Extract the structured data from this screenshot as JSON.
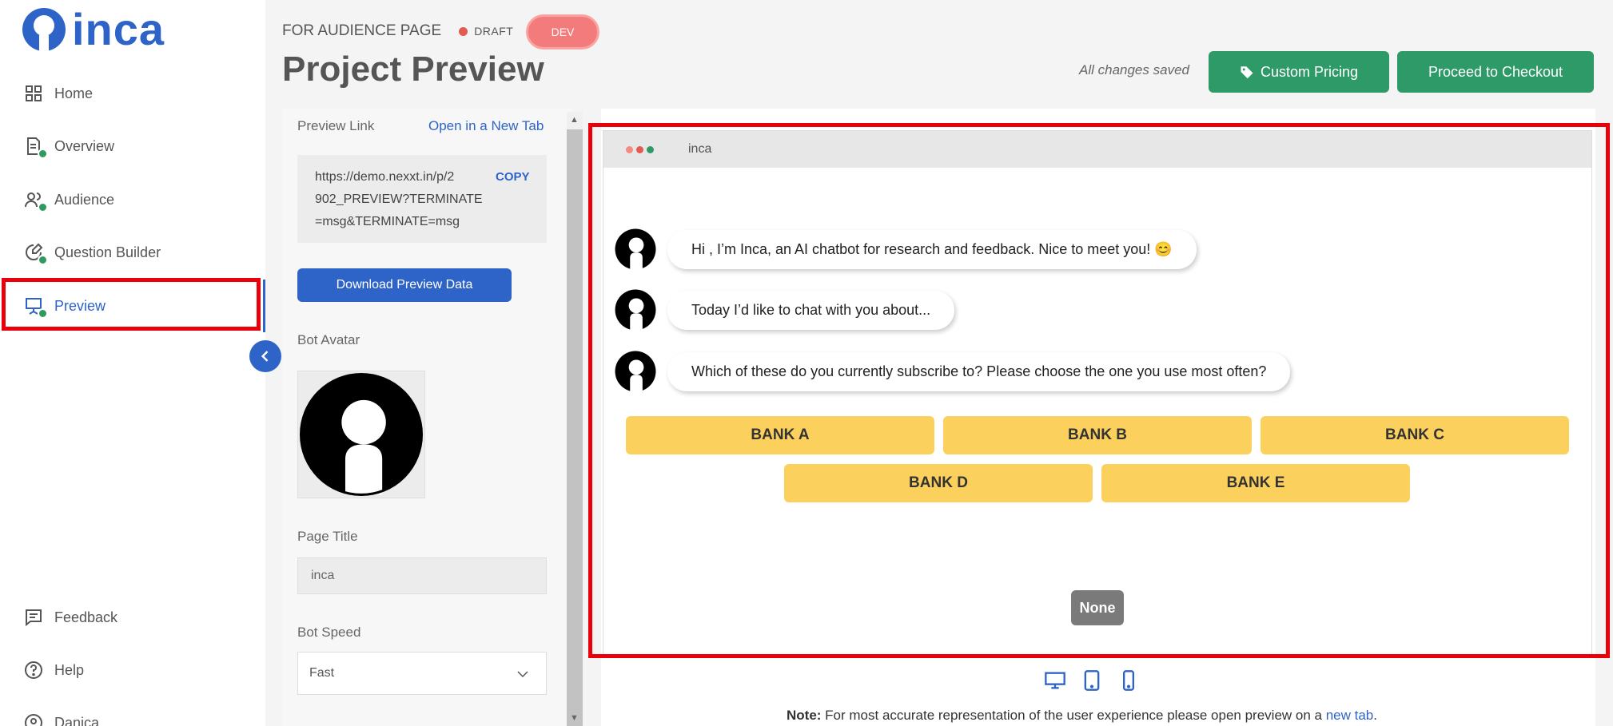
{
  "app": {
    "logo_text": "inca"
  },
  "sidebar": {
    "items": [
      {
        "label": "Home",
        "icon": "grid-icon"
      },
      {
        "label": "Overview",
        "icon": "document-icon"
      },
      {
        "label": "Audience",
        "icon": "users-icon"
      },
      {
        "label": "Question Builder",
        "icon": "question-builder-icon"
      },
      {
        "label": "Preview",
        "icon": "presentation-icon",
        "active": true
      },
      {
        "label": "Feedback",
        "icon": "feedback-icon"
      },
      {
        "label": "Help",
        "icon": "help-icon"
      },
      {
        "label": "Danica",
        "icon": "user-icon"
      }
    ]
  },
  "header": {
    "breadcrumb": "FOR AUDIENCE PAGE",
    "status": "DRAFT",
    "env_badge": "DEV",
    "title": "Project Preview",
    "saved_text": "All changes saved",
    "custom_pricing_label": "Custom Pricing",
    "checkout_label": "Proceed to Checkout"
  },
  "settings": {
    "preview_link_label": "Preview Link",
    "open_new_tab_label": "Open in a New Tab",
    "preview_url_line1": "https://demo.nexxt.in/p/2",
    "preview_url_line2": "902_PREVIEW?TERMINATE",
    "preview_url_line3": "=msg&TERMINATE=msg",
    "copy_label": "COPY",
    "download_label": "Download Preview Data",
    "bot_avatar_label": "Bot Avatar",
    "page_title_label": "Page Title",
    "page_title_value": "inca",
    "bot_speed_label": "Bot Speed",
    "bot_speed_value": "Fast"
  },
  "preview": {
    "browser_title": "inca",
    "messages": [
      "Hi , I’m Inca, an AI chatbot for research and feedback. Nice to meet you! 😊",
      "Today I’d like to chat with you  about...",
      "Which of these do you currently subscribe to? Please choose the one you use most often?"
    ],
    "options": [
      "BANK A",
      "BANK B",
      "BANK C",
      "BANK D",
      "BANK E"
    ],
    "none_label": "None",
    "note_label": "Note:",
    "note_text": " For most accurate representation of the user experience please open preview on a ",
    "note_link": "new tab",
    "note_end": "."
  },
  "colors": {
    "brand_blue": "#2e64c8",
    "green": "#2e9a68",
    "option_yellow": "#fcd05c",
    "highlight_red": "#e8000b",
    "dev_badge": "#f47b7b"
  }
}
